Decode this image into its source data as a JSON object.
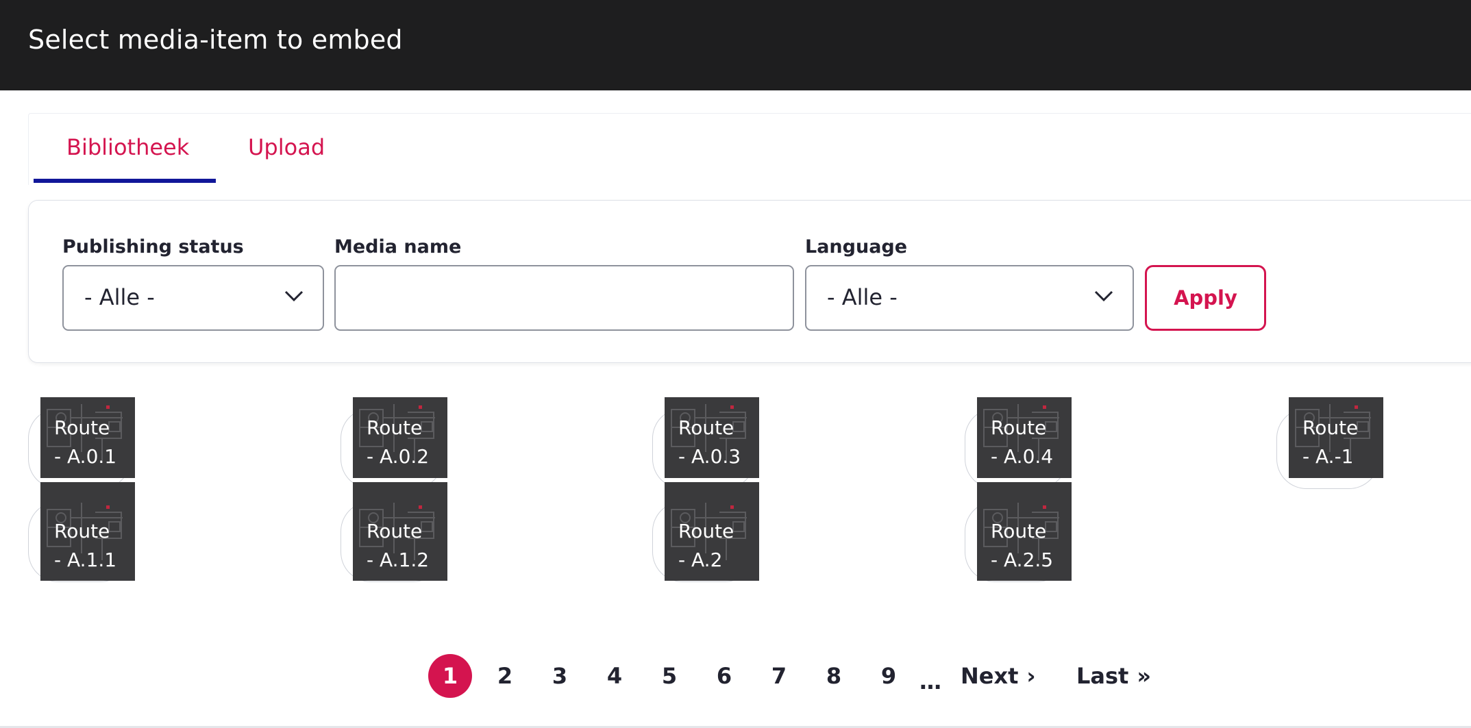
{
  "dialog": {
    "title": "Select media-item to embed"
  },
  "tabs": [
    {
      "label": "Bibliotheek",
      "active": true
    },
    {
      "label": "Upload",
      "active": false
    }
  ],
  "filters": {
    "status": {
      "label": "Publishing status",
      "value": "- Alle -"
    },
    "name": {
      "label": "Media name",
      "value": ""
    },
    "language": {
      "label": "Language",
      "value": "- Alle -"
    },
    "apply_label": "Apply"
  },
  "media": [
    {
      "line1": "Route",
      "line2": "- A.0.1"
    },
    {
      "line1": "Route",
      "line2": "- A.0.2"
    },
    {
      "line1": "Route",
      "line2": "- A.0.3"
    },
    {
      "line1": "Route",
      "line2": "- A.0.4"
    },
    {
      "line1": "Route",
      "line2": "- A.-1"
    },
    {
      "line1": "Route",
      "line2": "- A.1.1"
    },
    {
      "line1": "Route",
      "line2": "- A.1.2"
    },
    {
      "line1": "Route",
      "line2": "- A.2"
    },
    {
      "line1": "Route",
      "line2": "- A.2.5"
    }
  ],
  "pager": {
    "pages": [
      "1",
      "2",
      "3",
      "4",
      "5",
      "6",
      "7",
      "8",
      "9"
    ],
    "current": "1",
    "ellipsis": "…",
    "next_label": "Next",
    "next_icon": "›",
    "last_label": "Last",
    "last_icon": "»"
  },
  "colors": {
    "accent": "#d4144f",
    "tab_indicator": "#111799",
    "titlebar": "#1e1e1f"
  }
}
